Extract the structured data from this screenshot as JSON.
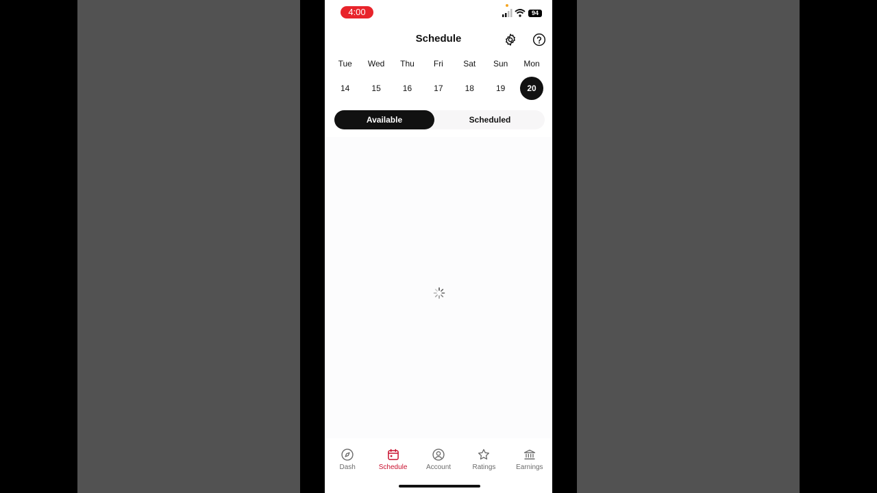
{
  "status_bar": {
    "time": "4:00",
    "battery": "94"
  },
  "header": {
    "title": "Schedule"
  },
  "week": {
    "days": [
      {
        "weekday": "Tue",
        "date": "14"
      },
      {
        "weekday": "Wed",
        "date": "15"
      },
      {
        "weekday": "Thu",
        "date": "16"
      },
      {
        "weekday": "Fri",
        "date": "17"
      },
      {
        "weekday": "Sat",
        "date": "18"
      },
      {
        "weekday": "Sun",
        "date": "19"
      },
      {
        "weekday": "Mon",
        "date": "20"
      }
    ],
    "selected_date": "20"
  },
  "toggle": {
    "available_label": "Available",
    "scheduled_label": "Scheduled",
    "active": "Available"
  },
  "tabs": [
    {
      "label": "Dash",
      "icon": "compass-icon"
    },
    {
      "label": "Schedule",
      "icon": "calendar-icon"
    },
    {
      "label": "Account",
      "icon": "user-circle-icon"
    },
    {
      "label": "Ratings",
      "icon": "star-icon"
    },
    {
      "label": "Earnings",
      "icon": "bank-icon"
    }
  ],
  "active_tab": "Schedule",
  "colors": {
    "accent": "#c8102e",
    "time_pill": "#e8242b",
    "selected": "#111111"
  }
}
